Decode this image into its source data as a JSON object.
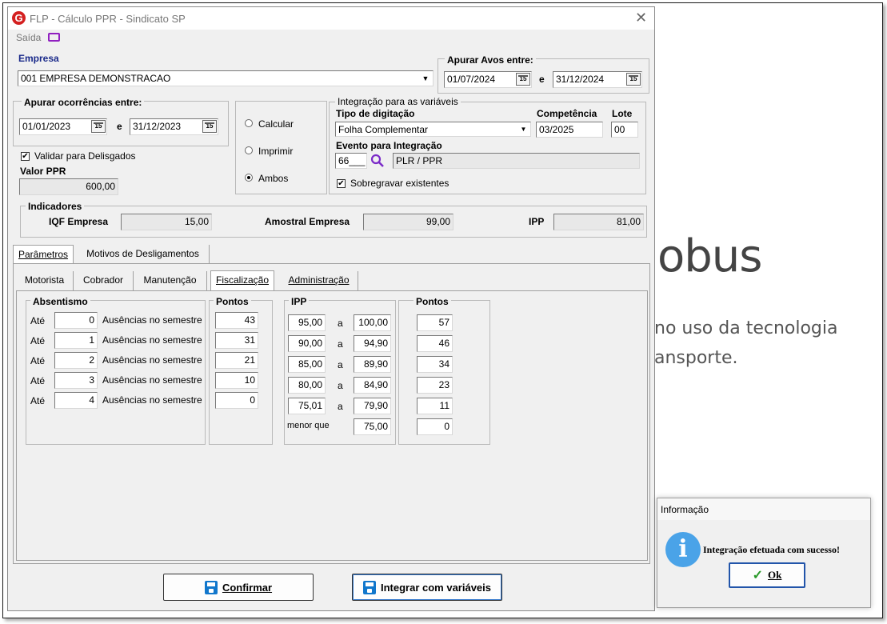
{
  "window": {
    "title": "FLP - Cálculo PPR - Sindicato SP",
    "exit_label": "Saída"
  },
  "empresa": {
    "label": "Empresa",
    "value": "001 EMPRESA DEMONSTRACAO"
  },
  "avos": {
    "label": "Apurar Avos entre:",
    "start": "01/07/2024",
    "sep": "e",
    "end": "31/12/2024"
  },
  "ocorrencias": {
    "label": "Apurar ocorrências entre:",
    "start": "01/01/2023",
    "sep": "e",
    "end": "31/12/2023",
    "validar_label": "Validar para Delisgados",
    "validar_checked": true,
    "valor_label": "Valor PPR",
    "valor": "600,00"
  },
  "modo": {
    "options": [
      "Calcular",
      "Imprimir",
      "Ambos"
    ],
    "selected": "Ambos"
  },
  "integracao": {
    "legend": "Integração para as variáveis",
    "tipo_label": "Tipo de digitação",
    "tipo_value": "Folha Complementar",
    "competencia_label": "Competência",
    "competencia": "03/2025",
    "lote_label": "Lote",
    "lote": "00",
    "evento_label": "Evento para Integração",
    "evento_code": "66___",
    "evento_desc": "PLR / PPR",
    "sobregravar_label": "Sobregravar existentes",
    "sobregravar_checked": true
  },
  "indicadores": {
    "legend": "Indicadores",
    "iqf_label": "IQF Empresa",
    "iqf": "15,00",
    "amostral_label": "Amostral Empresa",
    "amostral": "99,00",
    "ipp_label": "IPP",
    "ipp": "81,00"
  },
  "tabs_main": [
    "Parâmetros",
    "Motivos de Desligamentos"
  ],
  "tabs_sub": [
    "Motorista",
    "Cobrador",
    "Manutenção",
    "Fiscalização",
    "Administração"
  ],
  "absentismo": {
    "title": "Absentismo",
    "pontos_title": "Pontos",
    "rows": [
      {
        "prefix": "Até",
        "value": "0",
        "text": "Ausências no semestre",
        "pontos": "43"
      },
      {
        "prefix": "Até",
        "value": "1",
        "text": "Ausências no semestre",
        "pontos": "31"
      },
      {
        "prefix": "Até",
        "value": "2",
        "text": "Ausências no semestre",
        "pontos": "21"
      },
      {
        "prefix": "Até",
        "value": "3",
        "text": "Ausências no semestre",
        "pontos": "10"
      },
      {
        "prefix": "Até",
        "value": "4",
        "text": "Ausências no semestre",
        "pontos": "0"
      }
    ]
  },
  "ipp_table": {
    "title": "IPP",
    "pontos_title": "Pontos",
    "sep": "a",
    "rows": [
      {
        "from": "95,00",
        "to": "100,00",
        "pontos": "57"
      },
      {
        "from": "90,00",
        "to": "94,90",
        "pontos": "46"
      },
      {
        "from": "85,00",
        "to": "89,90",
        "pontos": "34"
      },
      {
        "from": "80,00",
        "to": "84,90",
        "pontos": "23"
      },
      {
        "from": "75,01",
        "to": "79,90",
        "pontos": "11"
      }
    ],
    "menor_label": "menor que",
    "menor_value": "75,00",
    "menor_pontos": "0"
  },
  "buttons": {
    "confirmar": "Confirmar",
    "integrar": "Integrar com variáveis"
  },
  "background": {
    "line1": "obus",
    "line2": "no uso da tecnologia",
    "line3": "ansporte."
  },
  "dialog": {
    "title": "Informação",
    "message": "Integração efetuada com sucesso!",
    "ok": "Ok"
  },
  "calendar_glyph": "15"
}
